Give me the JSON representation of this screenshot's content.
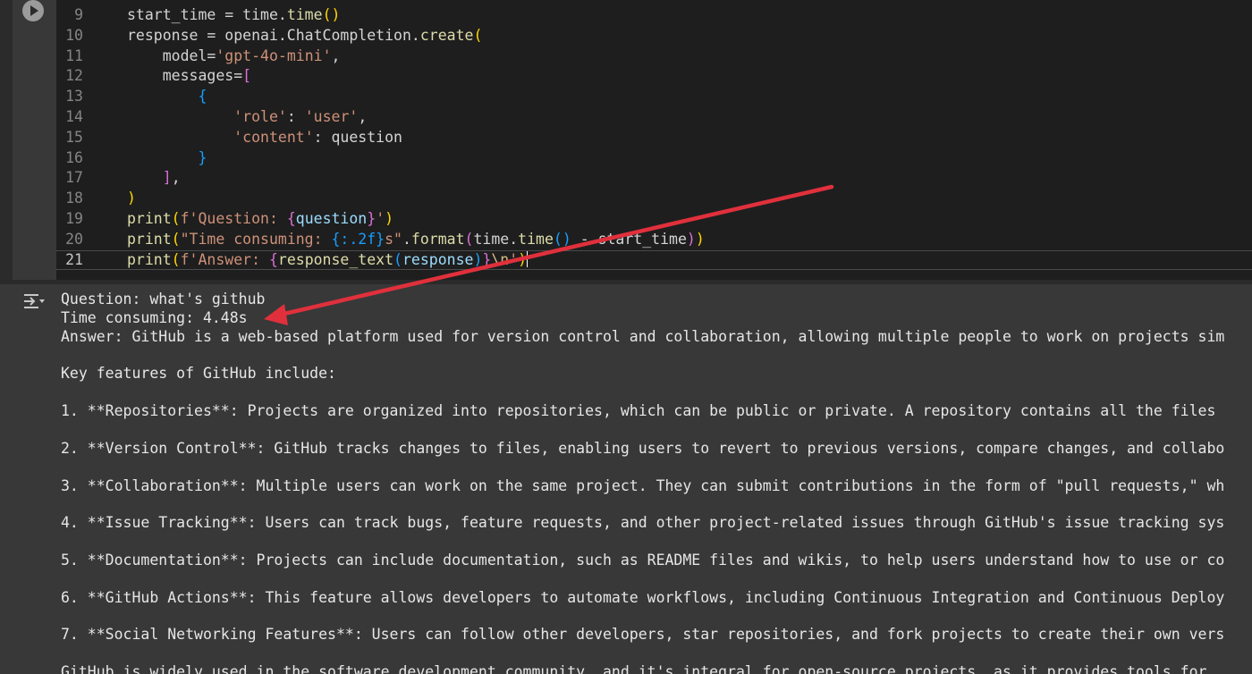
{
  "code": {
    "lines": [
      {
        "n": "9",
        "indent": "",
        "tokens": [
          {
            "c": "t-plain",
            "t": "start_time = time."
          },
          {
            "c": "t-fn",
            "t": "time"
          },
          {
            "c": "t-b1",
            "t": "()"
          }
        ]
      },
      {
        "n": "10",
        "indent": "",
        "tokens": [
          {
            "c": "t-plain",
            "t": "response = openai.ChatCompletion."
          },
          {
            "c": "t-fn",
            "t": "create"
          },
          {
            "c": "t-b1",
            "t": "("
          }
        ]
      },
      {
        "n": "11",
        "indent": "    ",
        "tokens": [
          {
            "c": "t-plain",
            "t": "model="
          },
          {
            "c": "t-str",
            "t": "'gpt-4o-mini'"
          },
          {
            "c": "t-plain",
            "t": ","
          }
        ]
      },
      {
        "n": "12",
        "indent": "    ",
        "tokens": [
          {
            "c": "t-plain",
            "t": "messages="
          },
          {
            "c": "t-b2",
            "t": "["
          }
        ]
      },
      {
        "n": "13",
        "indent": "        ",
        "tokens": [
          {
            "c": "t-b3",
            "t": "{"
          }
        ]
      },
      {
        "n": "14",
        "indent": "            ",
        "tokens": [
          {
            "c": "t-str",
            "t": "'role'"
          },
          {
            "c": "t-plain",
            "t": ": "
          },
          {
            "c": "t-str",
            "t": "'user'"
          },
          {
            "c": "t-plain",
            "t": ","
          }
        ]
      },
      {
        "n": "15",
        "indent": "            ",
        "tokens": [
          {
            "c": "t-str",
            "t": "'content'"
          },
          {
            "c": "t-plain",
            "t": ": question"
          }
        ]
      },
      {
        "n": "16",
        "indent": "        ",
        "tokens": [
          {
            "c": "t-b3",
            "t": "}"
          }
        ]
      },
      {
        "n": "17",
        "indent": "    ",
        "tokens": [
          {
            "c": "t-b2",
            "t": "]"
          },
          {
            "c": "t-plain",
            "t": ","
          }
        ]
      },
      {
        "n": "18",
        "indent": "",
        "tokens": [
          {
            "c": "t-b1",
            "t": ")"
          }
        ]
      },
      {
        "n": "19",
        "indent": "",
        "tokens": [
          {
            "c": "t-fn",
            "t": "print"
          },
          {
            "c": "t-b1",
            "t": "("
          },
          {
            "c": "t-str",
            "t": "f'Question: "
          },
          {
            "c": "t-b2",
            "t": "{"
          },
          {
            "c": "t-var",
            "t": "question"
          },
          {
            "c": "t-b2",
            "t": "}"
          },
          {
            "c": "t-str",
            "t": "'"
          },
          {
            "c": "t-b1",
            "t": ")"
          }
        ]
      },
      {
        "n": "20",
        "indent": "",
        "tokens": [
          {
            "c": "t-fn",
            "t": "print"
          },
          {
            "c": "t-b1",
            "t": "("
          },
          {
            "c": "t-str",
            "t": "\"Time consuming: "
          },
          {
            "c": "t-b3",
            "t": "{:.2f}"
          },
          {
            "c": "t-str",
            "t": "s\""
          },
          {
            "c": "t-plain",
            "t": "."
          },
          {
            "c": "t-fn",
            "t": "format"
          },
          {
            "c": "t-b2",
            "t": "("
          },
          {
            "c": "t-plain",
            "t": "time."
          },
          {
            "c": "t-fn",
            "t": "time"
          },
          {
            "c": "t-b3",
            "t": "()"
          },
          {
            "c": "t-plain",
            "t": " - start_time"
          },
          {
            "c": "t-b2",
            "t": ")"
          },
          {
            "c": "t-b1",
            "t": ")"
          }
        ]
      },
      {
        "n": "21",
        "indent": "",
        "tokens": [
          {
            "c": "t-fn",
            "t": "print"
          },
          {
            "c": "t-b1",
            "t": "("
          },
          {
            "c": "t-str",
            "t": "f'Answer: "
          },
          {
            "c": "t-b2",
            "t": "{"
          },
          {
            "c": "t-fn",
            "t": "response_text"
          },
          {
            "c": "t-b3",
            "t": "("
          },
          {
            "c": "t-var",
            "t": "response"
          },
          {
            "c": "t-b3",
            "t": ")"
          },
          {
            "c": "t-b2",
            "t": "}"
          },
          {
            "c": "t-esc",
            "t": "\\n"
          },
          {
            "c": "t-str",
            "t": "'"
          },
          {
            "c": "t-b1",
            "t": ")"
          }
        ]
      }
    ]
  },
  "output": {
    "lines": [
      "Question: what's github",
      "Time consuming: 4.48s",
      "Answer: GitHub is a web-based platform used for version control and collaboration, allowing multiple people to work on projects sim",
      "",
      "Key features of GitHub include:",
      "",
      "1. **Repositories**: Projects are organized into repositories, which can be public or private. A repository contains all the files",
      "",
      "2. **Version Control**: GitHub tracks changes to files, enabling users to revert to previous versions, compare changes, and collabo",
      "",
      "3. **Collaboration**: Multiple users can work on the same project. They can submit contributions in the form of \"pull requests,\" wh",
      "",
      "4. **Issue Tracking**: Users can track bugs, feature requests, and other project-related issues through GitHub's issue tracking sys",
      "",
      "5. **Documentation**: Projects can include documentation, such as README files and wikis, to help users understand how to use or co",
      "",
      "6. **GitHub Actions**: This feature allows developers to automate workflows, including Continuous Integration and Continuous Deploy",
      "",
      "7. **Social Networking Features**: Users can follow other developers, star repositories, and fork projects to create their own vers",
      "",
      "GitHub is widely used in the software development community, and it's integral for open-source projects, as it provides tools for"
    ]
  },
  "colors": {
    "annotation_arrow": "#e0303c"
  },
  "icons": {
    "run": "play-circle-icon",
    "output_toggle": "output-toggle-icon"
  }
}
